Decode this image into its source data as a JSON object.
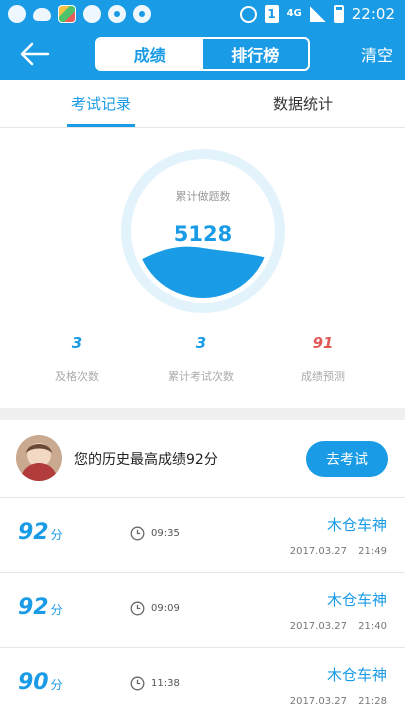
{
  "status_bar": {
    "left_icons": [
      "qq-icon",
      "cloud-icon",
      "app-color-icon",
      "wechat-icon",
      "message-icon",
      "notification-icon"
    ],
    "network": "4G",
    "sim": "1",
    "time": "22:02"
  },
  "nav": {
    "back_icon": "arrow-left-icon",
    "tabs": [
      {
        "label": "成绩",
        "active": true
      },
      {
        "label": "排行榜",
        "active": false
      }
    ],
    "clear_label": "清空"
  },
  "subtabs": [
    {
      "label": "考试记录",
      "active": true
    },
    {
      "label": "数据统计",
      "active": false
    }
  ],
  "gauge": {
    "label": "累计做题数",
    "value": "5128"
  },
  "stats": [
    {
      "value": "3",
      "label": "及格次数",
      "color": "#1a9be6"
    },
    {
      "value": "3",
      "label": "累计考试次数",
      "color": "#1a9be6"
    },
    {
      "value": "91",
      "label": "成绩预测",
      "color": "#e05a5a"
    }
  ],
  "best": {
    "text": "您的历史最高成绩92分",
    "button_label": "去考试"
  },
  "records": [
    {
      "score": "92",
      "unit": "分",
      "duration": "09:35",
      "name": "木仓车神",
      "date": "2017.03.27",
      "time": "21:49"
    },
    {
      "score": "92",
      "unit": "分",
      "duration": "09:09",
      "name": "木仓车神",
      "date": "2017.03.27",
      "time": "21:40"
    },
    {
      "score": "90",
      "unit": "分",
      "duration": "11:38",
      "name": "木仓车神",
      "date": "2017.03.27",
      "time": "21:28"
    }
  ],
  "colors": {
    "brand": "#1a9be6",
    "prediction": "#e05a5a"
  }
}
